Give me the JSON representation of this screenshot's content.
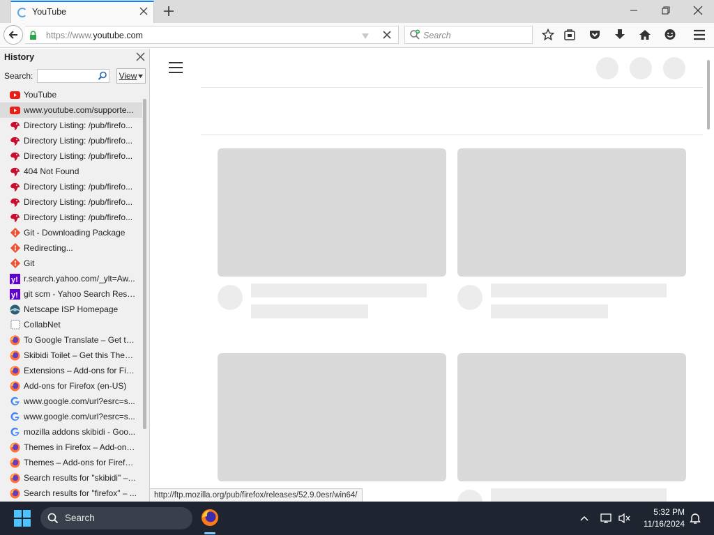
{
  "tab": {
    "title": "YouTube"
  },
  "nav": {
    "url_scheme": "https://www.",
    "url_host": "youtube.com",
    "search_placeholder": "Search"
  },
  "sidebar": {
    "title": "History",
    "search_label": "Search:",
    "search_value": "",
    "view_label": "View",
    "items": [
      {
        "label": "YouTube",
        "icon": "youtube-icon"
      },
      {
        "label": "www.youtube.com/supporte...",
        "icon": "youtube-icon"
      },
      {
        "label": "Directory Listing: /pub/firefo...",
        "icon": "mozilla-dino-icon"
      },
      {
        "label": "Directory Listing: /pub/firefo...",
        "icon": "mozilla-dino-icon"
      },
      {
        "label": "Directory Listing: /pub/firefo...",
        "icon": "mozilla-dino-icon"
      },
      {
        "label": "404 Not Found",
        "icon": "mozilla-dino-icon"
      },
      {
        "label": "Directory Listing: /pub/firefo...",
        "icon": "mozilla-dino-icon"
      },
      {
        "label": "Directory Listing: /pub/firefo...",
        "icon": "mozilla-dino-icon"
      },
      {
        "label": "Directory Listing: /pub/firefo...",
        "icon": "mozilla-dino-icon"
      },
      {
        "label": "Git - Downloading Package",
        "icon": "git-icon"
      },
      {
        "label": "Redirecting...",
        "icon": "git-icon"
      },
      {
        "label": "Git",
        "icon": "git-icon"
      },
      {
        "label": "r.search.yahoo.com/_ylt=Aw...",
        "icon": "yahoo-icon"
      },
      {
        "label": "git scm - Yahoo Search Results",
        "icon": "yahoo-icon"
      },
      {
        "label": "Netscape ISP Homepage",
        "icon": "netscape-icon"
      },
      {
        "label": "CollabNet",
        "icon": "blank-page-icon"
      },
      {
        "label": "To Google Translate – Get thi...",
        "icon": "firefox-icon"
      },
      {
        "label": "Skibidi Toilet – Get this Them...",
        "icon": "firefox-icon"
      },
      {
        "label": "Extensions – Add-ons for Fire...",
        "icon": "firefox-icon"
      },
      {
        "label": "Add-ons for Firefox (en-US)",
        "icon": "firefox-icon"
      },
      {
        "label": "www.google.com/url?esrc=s...",
        "icon": "google-icon"
      },
      {
        "label": "www.google.com/url?esrc=s...",
        "icon": "google-icon"
      },
      {
        "label": "mozilla addons skibidi - Goo...",
        "icon": "google-icon"
      },
      {
        "label": "Themes in Firefox – Add-ons ...",
        "icon": "firefox-icon"
      },
      {
        "label": "Themes – Add-ons for Firefo...",
        "icon": "firefox-icon"
      },
      {
        "label": "Search results for \"skibidi\" – ...",
        "icon": "firefox-icon"
      },
      {
        "label": "Search results for \"firefox\" – ...",
        "icon": "firefox-icon"
      }
    ]
  },
  "status": {
    "link": "http://ftp.mozilla.org/pub/firefox/releases/52.9.0esr/win64/"
  },
  "taskbar": {
    "search_label": "Search",
    "time": "5:32 PM",
    "date": "11/16/2024"
  },
  "colors": {
    "tab_accent": "#0a84ff",
    "lock_green": "#2ea44f",
    "taskbar_bg": "#1f2530",
    "start_blue": "#4cc2ff",
    "placeholder_gray": "#d9d9d9"
  }
}
